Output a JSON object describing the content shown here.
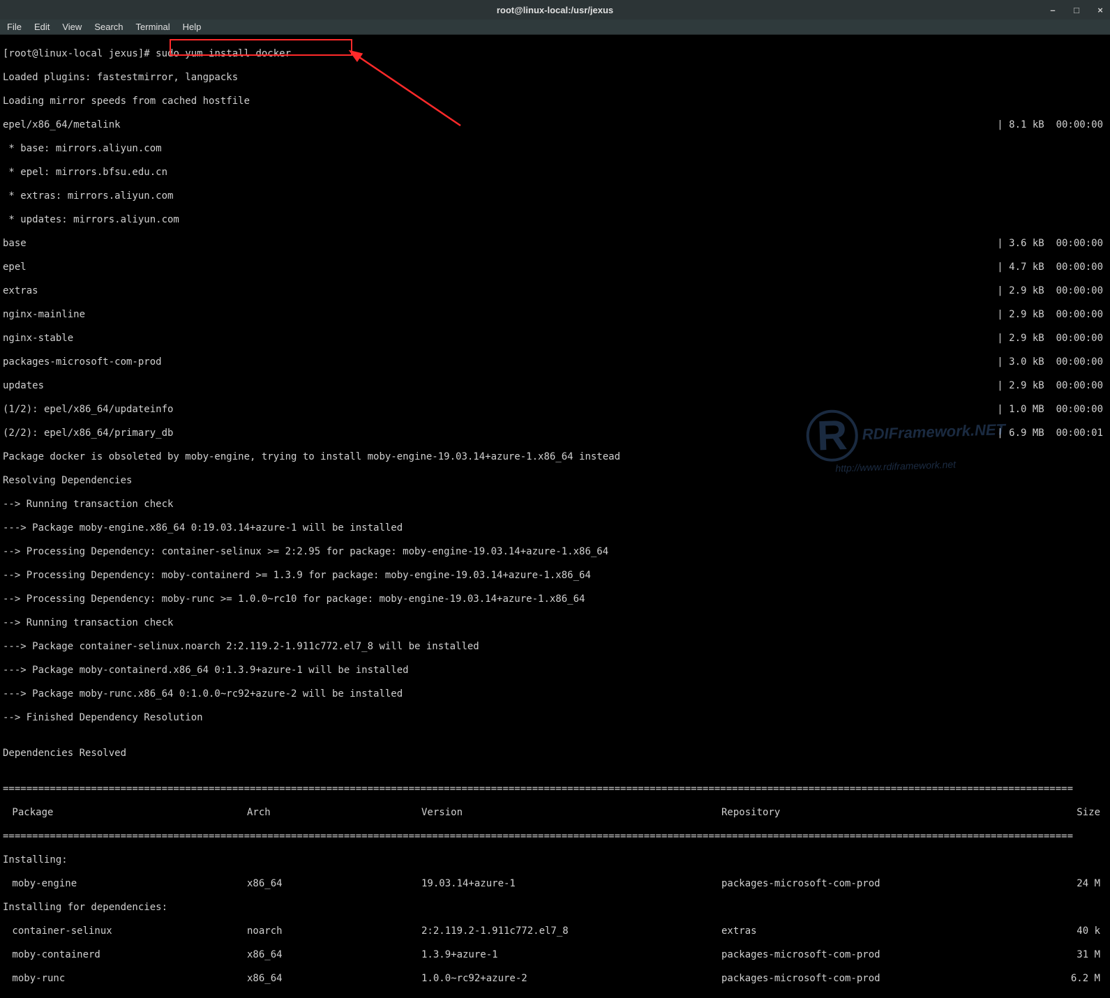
{
  "window": {
    "title": "root@linux-local:/usr/jexus"
  },
  "menu": {
    "file": "File",
    "edit": "Edit",
    "view": "View",
    "search": "Search",
    "terminal": "Terminal",
    "help": "Help"
  },
  "prompt": {
    "prefix": "[root@linux-local jexus]# ",
    "command": "sudo yum install docker"
  },
  "lines": {
    "l1": "Loaded plugins: fastestmirror, langpacks",
    "l2": "Loading mirror speeds from cached hostfile",
    "l3_left": "epel/x86_64/metalink",
    "l3_right": "| 8.1 kB  00:00:00",
    "l4": " * base: mirrors.aliyun.com",
    "l5": " * epel: mirrors.bfsu.edu.cn",
    "l6": " * extras: mirrors.aliyun.com",
    "l7": " * updates: mirrors.aliyun.com",
    "l8_left": "base",
    "l8_right": "| 3.6 kB  00:00:00",
    "l9_left": "epel",
    "l9_right": "| 4.7 kB  00:00:00",
    "l10_left": "extras",
    "l10_right": "| 2.9 kB  00:00:00",
    "l11_left": "nginx-mainline",
    "l11_right": "| 2.9 kB  00:00:00",
    "l12_left": "nginx-stable",
    "l12_right": "| 2.9 kB  00:00:00",
    "l13_left": "packages-microsoft-com-prod",
    "l13_right": "| 3.0 kB  00:00:00",
    "l14_left": "updates",
    "l14_right": "| 2.9 kB  00:00:00",
    "l15_left": "(1/2): epel/x86_64/updateinfo",
    "l15_right": "| 1.0 MB  00:00:00",
    "l16_left": "(2/2): epel/x86_64/primary_db",
    "l16_right": "| 6.9 MB  00:00:01",
    "l17": "Package docker is obsoleted by moby-engine, trying to install moby-engine-19.03.14+azure-1.x86_64 instead",
    "l18": "Resolving Dependencies",
    "l19": "--> Running transaction check",
    "l20": "---> Package moby-engine.x86_64 0:19.03.14+azure-1 will be installed",
    "l21": "--> Processing Dependency: container-selinux >= 2:2.95 for package: moby-engine-19.03.14+azure-1.x86_64",
    "l22": "--> Processing Dependency: moby-containerd >= 1.3.9 for package: moby-engine-19.03.14+azure-1.x86_64",
    "l23": "--> Processing Dependency: moby-runc >= 1.0.0~rc10 for package: moby-engine-19.03.14+azure-1.x86_64",
    "l24": "--> Running transaction check",
    "l25": "---> Package container-selinux.noarch 2:2.119.2-1.911c772.el7_8 will be installed",
    "l26": "---> Package moby-containerd.x86_64 0:1.3.9+azure-1 will be installed",
    "l27": "---> Package moby-runc.x86_64 0:1.0.0~rc92+azure-2 will be installed",
    "l28": "--> Finished Dependency Resolution",
    "l29": "",
    "l30": "Dependencies Resolved",
    "l31": ""
  },
  "table": {
    "headers": {
      "package": " Package",
      "arch": "Arch",
      "version": "Version",
      "repository": "Repository",
      "size": "Size"
    },
    "installing_label": "Installing:",
    "installing_deps_label": "Installing for dependencies:",
    "rows": [
      {
        "pkg": " moby-engine",
        "arch": "x86_64",
        "ver": "19.03.14+azure-1",
        "repo": "packages-microsoft-com-prod",
        "size": "24 M"
      },
      {
        "pkg": " container-selinux",
        "arch": "noarch",
        "ver": "2:2.119.2-1.911c772.el7_8",
        "repo": "extras",
        "size": "40 k"
      },
      {
        "pkg": " moby-containerd",
        "arch": "x86_64",
        "ver": "1.3.9+azure-1",
        "repo": "packages-microsoft-com-prod",
        "size": "31 M"
      },
      {
        "pkg": " moby-runc",
        "arch": "x86_64",
        "ver": "1.0.0~rc92+azure-2",
        "repo": "packages-microsoft-com-prod",
        "size": "6.2 M"
      }
    ]
  },
  "sep": "======================================================================================================================================================================================"
}
